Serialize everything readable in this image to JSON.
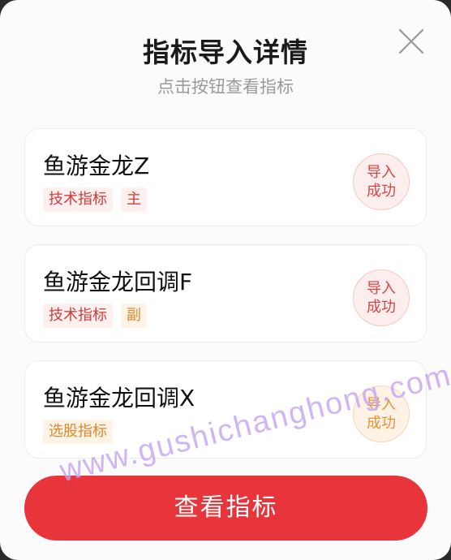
{
  "dialog": {
    "title": "指标导入详情",
    "subtitle": "点击按钮查看指标",
    "close_icon": "close-icon"
  },
  "indicators": [
    {
      "name": "鱼游金龙Z",
      "tags": [
        {
          "label": "技术指标",
          "color": "#d63a3a"
        },
        {
          "label": "主",
          "color": "#d63a3a"
        }
      ],
      "status_line1": "导入",
      "status_line2": "成功",
      "status_color": "#d64545"
    },
    {
      "name": "鱼游金龙回调F",
      "tags": [
        {
          "label": "技术指标",
          "color": "#d63a3a"
        },
        {
          "label": "副",
          "color": "#e0892d"
        }
      ],
      "status_line1": "导入",
      "status_line2": "成功",
      "status_color": "#d64545"
    },
    {
      "name": "鱼游金龙回调X",
      "tags": [
        {
          "label": "选股指标",
          "color": "#e0892d"
        }
      ],
      "status_line1": "导入",
      "status_line2": "成功",
      "status_color": "#e4913a"
    }
  ],
  "view_button": {
    "label": "查看指标",
    "color": "#e8353b"
  },
  "watermark": "www.gushichanghong.com"
}
